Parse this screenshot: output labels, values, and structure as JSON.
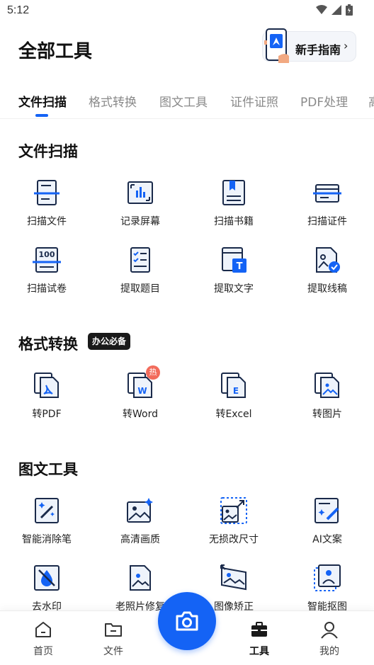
{
  "status_bar": {
    "time": "5:12"
  },
  "header": {
    "title": "全部工具",
    "guide_label": "新手指南",
    "guide_chevron": "›"
  },
  "tabs": [
    {
      "label": "文件扫描",
      "active": true
    },
    {
      "label": "格式转换"
    },
    {
      "label": "图文工具"
    },
    {
      "label": "证件证照"
    },
    {
      "label": "PDF处理"
    },
    {
      "label": "高"
    }
  ],
  "sections": {
    "scan": {
      "title": "文件扫描",
      "items": [
        {
          "label": "扫描文件",
          "icon": "scan-document-icon"
        },
        {
          "label": "记录屏幕",
          "icon": "record-screen-icon"
        },
        {
          "label": "扫描书籍",
          "icon": "scan-book-icon"
        },
        {
          "label": "扫描证件",
          "icon": "scan-id-card-icon"
        },
        {
          "label": "扫描试卷",
          "icon": "scan-exam-paper-icon"
        },
        {
          "label": "提取题目",
          "icon": "extract-questions-icon"
        },
        {
          "label": "提取文字",
          "icon": "extract-text-icon"
        },
        {
          "label": "提取线稿",
          "icon": "extract-line-art-icon"
        }
      ]
    },
    "convert": {
      "title": "格式转换",
      "badge": "办公必备",
      "hot": "热",
      "items": [
        {
          "label": "转PDF",
          "icon": "pdf-file-icon"
        },
        {
          "label": "转Word",
          "icon": "word-file-icon"
        },
        {
          "label": "转Excel",
          "icon": "excel-file-icon"
        },
        {
          "label": "转图片",
          "icon": "image-file-icon"
        }
      ]
    },
    "image": {
      "title": "图文工具",
      "items": [
        {
          "label": "智能消除笔",
          "icon": "magic-eraser-icon"
        },
        {
          "label": "高清画质",
          "icon": "hd-image-icon"
        },
        {
          "label": "无损改尺寸",
          "icon": "resize-image-icon"
        },
        {
          "label": "AI文案",
          "icon": "ai-copywriting-icon"
        },
        {
          "label": "去水印",
          "icon": "remove-watermark-icon"
        },
        {
          "label": "老照片修复",
          "icon": "old-photo-restore-icon"
        },
        {
          "label": "图像矫正",
          "icon": "image-correction-icon"
        },
        {
          "label": "智能抠图",
          "icon": "smart-cutout-icon"
        }
      ]
    }
  },
  "bottom_nav": [
    {
      "label": "首页",
      "icon": "home-icon"
    },
    {
      "label": "文件",
      "icon": "folder-icon"
    },
    {
      "label": "工具",
      "icon": "toolbox-icon",
      "active": true
    },
    {
      "label": "我的",
      "icon": "profile-icon"
    }
  ],
  "colors": {
    "accent": "#1463f5",
    "hot": "#f26b5b",
    "badge": "#1a1a1a"
  }
}
